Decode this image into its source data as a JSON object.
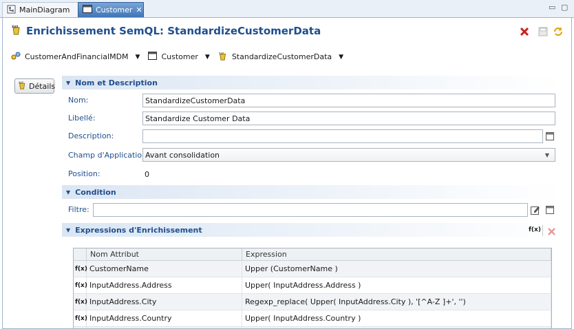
{
  "tabs": [
    {
      "label": "MainDiagram",
      "icon": "diagram-icon"
    },
    {
      "label": "Customer",
      "icon": "entity-icon"
    }
  ],
  "editor": {
    "title": "Enrichissement SemQL: StandardizeCustomerData"
  },
  "breadcrumb": {
    "model": "CustomerAndFinancialMDM",
    "entity": "Customer",
    "enricher": "StandardizeCustomerData"
  },
  "sidebar": {
    "details_label": "Détails"
  },
  "sections": {
    "description": "Nom et Description",
    "condition": "Condition",
    "expressions": "Expressions d'Enrichissement"
  },
  "form": {
    "name_label": "Nom:",
    "name_value": "StandardizeCustomerData",
    "label_label": "Libellé:",
    "label_value": "Standardize Customer Data",
    "description_label": "Description:",
    "description_value": "",
    "scope_label": "Champ d'Application:",
    "scope_value": "Avant consolidation",
    "position_label": "Position:",
    "position_value": "0",
    "filter_label": "Filtre:",
    "filter_value": ""
  },
  "table": {
    "fx": "f(x)",
    "headers": [
      "Nom Attribut",
      "Expression"
    ],
    "rows": [
      {
        "attribute": "CustomerName",
        "expression": "Upper (CustomerName )"
      },
      {
        "attribute": "InputAddress.Address",
        "expression": "Upper( InputAddress.Address )"
      },
      {
        "attribute": "InputAddress.City",
        "expression": "Regexp_replace( Upper( InputAddress.City ), '[^A-Z ]+', '')"
      },
      {
        "attribute": "InputAddress.Country",
        "expression": "Upper( InputAddress.Country )"
      }
    ]
  },
  "colors": {
    "title": "#1f4e8c",
    "active_tab": "#3f74b7",
    "delete": "#cc1f1f"
  }
}
